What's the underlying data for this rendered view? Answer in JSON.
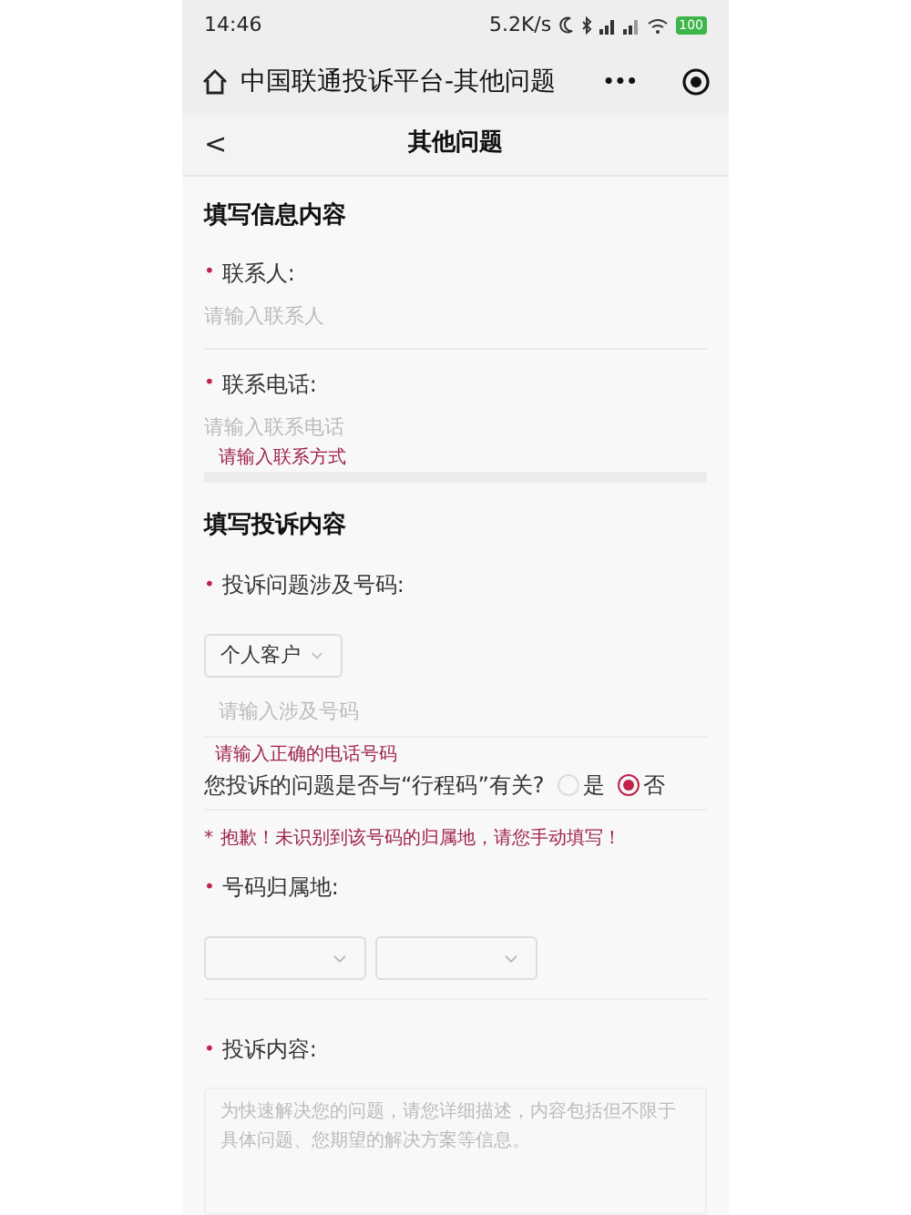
{
  "status_bar": {
    "time": "14:46",
    "speed": "5.2K/s",
    "battery": "100"
  },
  "mini_program_bar": {
    "title": "中国联通投诉平台-其他问题",
    "more": "•••"
  },
  "nav": {
    "back": "<",
    "title": "其他问题"
  },
  "contact_section": {
    "heading": "填写信息内容",
    "fields": [
      {
        "required_mark": "•",
        "label": "联系人:",
        "placeholder": "请输入联系人"
      },
      {
        "required_mark": "•",
        "label": "联系电话:",
        "placeholder": "请输入联系电话",
        "error": "请输入联系方式"
      }
    ]
  },
  "complaint_section": {
    "heading": "填写投诉内容",
    "number_field": {
      "required_mark": "•",
      "label": "投诉问题涉及号码:",
      "customer_type": "个人客户",
      "placeholder": "请输入涉及号码",
      "error": "请输入正确的电话号码"
    },
    "travel_code_question": {
      "text": "您投诉的问题是否与“行程码”有关?",
      "options": [
        {
          "label": "是",
          "selected": false
        },
        {
          "label": "否",
          "selected": true
        }
      ]
    },
    "warning": {
      "mark": "*",
      "text": "抱歉！未识别到该号码的归属地，请您手动填写！"
    },
    "location_field": {
      "required_mark": "•",
      "label": "号码归属地:"
    },
    "content_field": {
      "required_mark": "•",
      "label": "投诉内容:",
      "placeholder": "为快速解决您的问题，请您详细描述，内容包括但不限于具体问题、您期望的解决方案等信息。"
    }
  }
}
